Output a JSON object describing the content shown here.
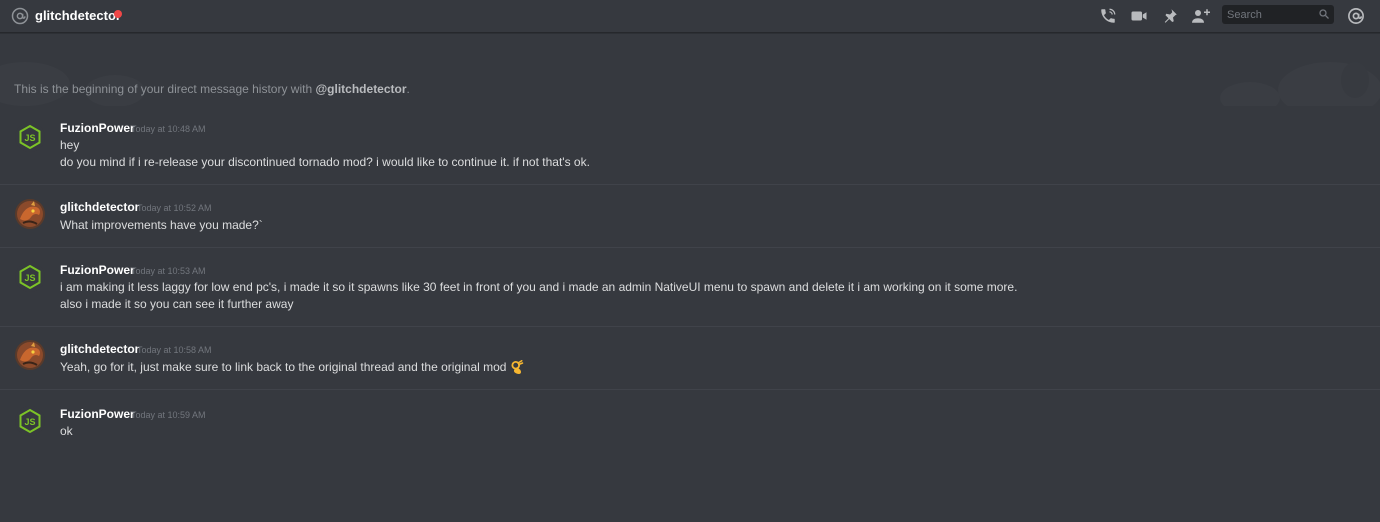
{
  "header": {
    "channel_name": "glitchdetector",
    "status_color": "#f04747",
    "icons": [
      "at-icon",
      "call-icon",
      "video-icon",
      "pin-icon",
      "add-friend-icon",
      "mention-icon"
    ],
    "search_placeholder": "Search"
  },
  "intro": {
    "prefix": "This is the beginning of your direct message history with ",
    "handle": "@glitchdetector",
    "suffix": "."
  },
  "messages": [
    {
      "author": "FuzionPower",
      "avatar": "nodejs-logo-avatar",
      "timestamp": "Today at 10:48 AM",
      "lines": [
        "hey",
        "do you mind if i re-release your discontinued tornado mod? i would like to continue it. if not that's ok."
      ]
    },
    {
      "author": "glitchdetector",
      "avatar": "dragon-avatar",
      "timestamp": "Today at 10:52 AM",
      "lines": [
        "What improvements have you made?`"
      ]
    },
    {
      "author": "FuzionPower",
      "avatar": "nodejs-logo-avatar",
      "timestamp": "Today at 10:53 AM",
      "lines": [
        "i am making it less laggy for low end pc's, i made it so it spawns like 30 feet in front of you and i made an admin NativeUI menu to spawn and delete it i am working on it some more.",
        "also i made it so you can see it further away"
      ]
    },
    {
      "author": "glitchdetector",
      "avatar": "dragon-avatar",
      "timestamp": "Today at 10:58 AM",
      "lines": [
        "Yeah, go for it, just make sure to link back to the original thread and the original mod"
      ],
      "emoji": "ok-hand-emoji"
    },
    {
      "author": "FuzionPower",
      "avatar": "nodejs-logo-avatar",
      "timestamp": "Today at 10:59 AM",
      "lines": [
        "ok"
      ]
    }
  ]
}
